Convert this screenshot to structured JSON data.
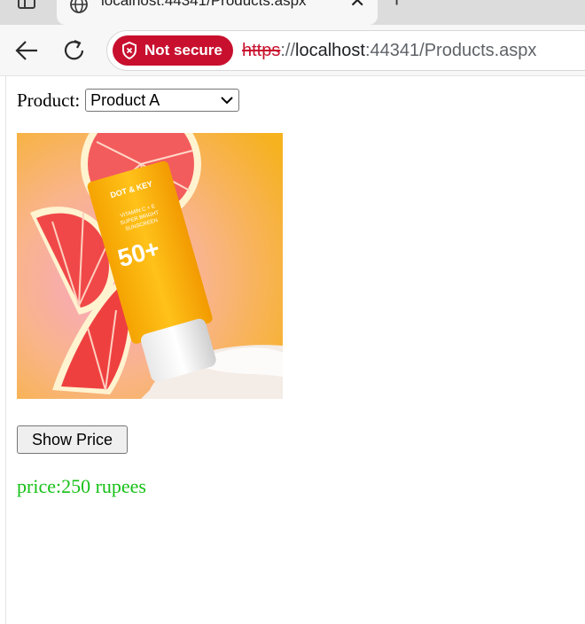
{
  "browser": {
    "tab_title": "localhost:44341/Products.aspx",
    "security_label": "Not secure",
    "url_scheme": "https",
    "url_separator": "://",
    "url_host": "localhost",
    "url_rest": ":44341/Products.aspx"
  },
  "page": {
    "product_label": "Product:",
    "selected_product": "Product A",
    "product_image_icon": "sunscreen-product-image",
    "show_price_label": "Show Price",
    "price_text": "price:250 rupees",
    "price_color": "#16c016"
  },
  "colors": {
    "security_chip": "#c8102e",
    "page_bg": "#ffffff"
  }
}
